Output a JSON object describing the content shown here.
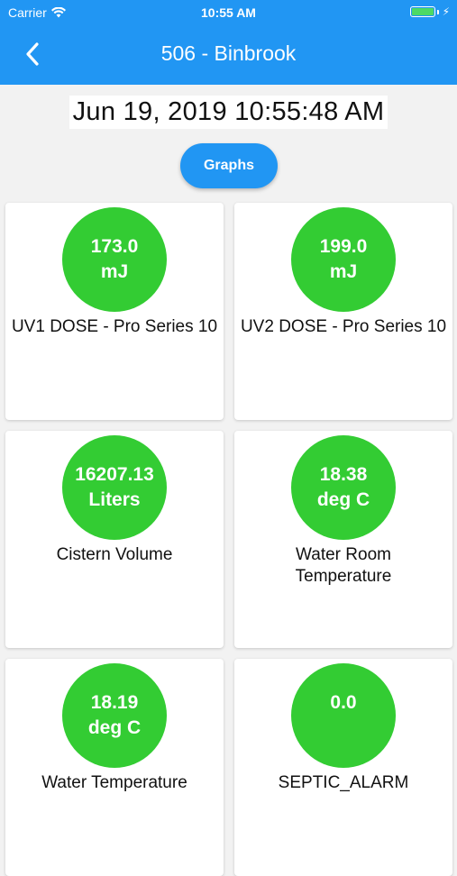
{
  "status_bar": {
    "carrier": "Carrier",
    "time": "10:55 AM",
    "battery_level": 1.0
  },
  "header": {
    "title": "506 - Binbrook",
    "back_icon": "chevron-left-icon",
    "background_color": "#2196f3"
  },
  "datetime": "Jun 19, 2019 10:55:48 AM",
  "graphs_button": {
    "label": "Graphs"
  },
  "cards": [
    {
      "value": "173.0",
      "unit": "mJ",
      "label": "UV1 DOSE - Pro Series 10"
    },
    {
      "value": "199.0",
      "unit": "mJ",
      "label": "UV2 DOSE - Pro Series 10"
    },
    {
      "value": "16207.13",
      "unit": "Liters",
      "label": "Cistern Volume"
    },
    {
      "value": "18.38",
      "unit": "deg C",
      "label": "Water Room Temperature"
    },
    {
      "value": "18.19",
      "unit": "deg C",
      "label": "Water Temperature"
    },
    {
      "value": "0.0",
      "unit": "",
      "label": "SEPTIC_ALARM"
    }
  ],
  "colors": {
    "accent": "#2196f3",
    "status_ok": "#33cc33"
  }
}
